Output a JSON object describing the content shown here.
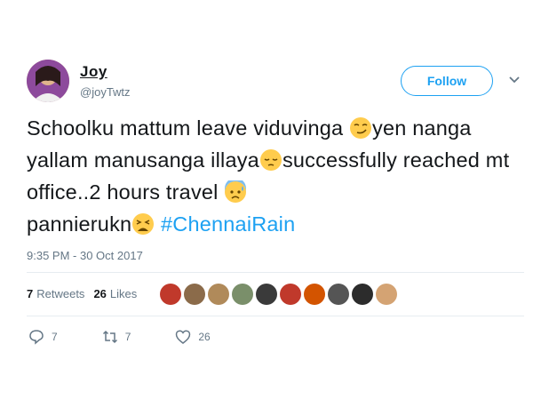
{
  "user": {
    "name": "Joy",
    "handle": "@joyTwtz"
  },
  "follow_label": "Follow",
  "tweet": {
    "segments": [
      "Schoolku mattum leave viduvinga ",
      "yen nanga yallam manusanga illaya",
      "successfully reached mt office..2 hours travel ",
      "pannierukn",
      " "
    ],
    "hashtag": "#ChennaiRain",
    "emojis": [
      "smirking-face",
      "pensive-face",
      "anxious-face-with-sweat",
      "tired-face"
    ]
  },
  "timestamp": "9:35 PM - 30 Oct 2017",
  "stats": {
    "retweets_count": "7",
    "retweets_label": "Retweets",
    "likes_count": "26",
    "likes_label": "Likes"
  },
  "likers": [
    "#c0392b",
    "#8b6b4a",
    "#b08a5a",
    "#7a8f6a",
    "#3a3a3a",
    "#c0392b",
    "#d35400",
    "#555555",
    "#2c2c2c",
    "#d4a373"
  ],
  "actions": {
    "reply_count": "7",
    "retweet_count": "7",
    "like_count": "26"
  },
  "colors": {
    "accent": "#1da1f2",
    "muted": "#657786",
    "text": "#14171a"
  }
}
